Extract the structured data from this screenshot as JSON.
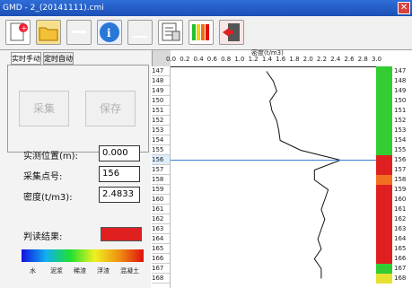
{
  "window": {
    "title": "GMD - 2_(20141111).cmi"
  },
  "toolbar": {
    "icons": [
      "new-file-icon",
      "open-folder-icon",
      "disabled-icon",
      "info-icon",
      "disabled-icon",
      "report-icon",
      "color-bars-icon",
      "exit-icon"
    ]
  },
  "tabs": [
    "实时手动",
    "定时自动"
  ],
  "buttons": {
    "collect": "采集",
    "save": "保存"
  },
  "fields": {
    "position_label": "实测位置(m):",
    "position_value": "0.000",
    "point_label": "采集点号:",
    "point_value": "156",
    "density_label": "密度(t/m3):",
    "density_value": "2.4833"
  },
  "result": {
    "label": "判读结果:",
    "color": "#e02020"
  },
  "colorbar": {
    "labels": [
      "水",
      "泥浆",
      "稀渣",
      "浮渣",
      "混凝土"
    ]
  },
  "chart": {
    "axis_label": "密度(t/m3)",
    "ticks": [
      "0.0",
      "0.2",
      "0.4",
      "0.6",
      "0.8",
      "1.0",
      "1.2",
      "1.4",
      "1.6",
      "1.8",
      "2.0",
      "2.2",
      "2.4",
      "2.6",
      "2.8",
      "3.0"
    ]
  },
  "depth_labels": [
    "147",
    "148",
    "149",
    "150",
    "151",
    "152",
    "153",
    "154",
    "155",
    "156",
    "157",
    "158",
    "159",
    "160",
    "161",
    "162",
    "163",
    "164",
    "165",
    "166",
    "167",
    "168"
  ],
  "result_colors": [
    "#33cc33",
    "#33cc33",
    "#33cc33",
    "#33cc33",
    "#33cc33",
    "#33cc33",
    "#33cc33",
    "#33cc33",
    "#33cc33",
    "#e02020",
    "#e02020",
    "#f07020",
    "#e02020",
    "#e02020",
    "#e02020",
    "#e02020",
    "#e02020",
    "#e02020",
    "#e02020",
    "#e02020",
    "#33cc33",
    "#e6e030"
  ],
  "chart_data": {
    "type": "line",
    "xlabel": "密度(t/m3)",
    "xlim": [
      0.0,
      3.0
    ],
    "ylim": [
      147,
      168
    ],
    "y": [
      147,
      148,
      149,
      150,
      151,
      152,
      153,
      154,
      155,
      156,
      157,
      158,
      159,
      160,
      161,
      162,
      163,
      164,
      165,
      166,
      167,
      168
    ],
    "x": [
      1.4,
      1.5,
      1.55,
      1.45,
      1.48,
      1.55,
      1.58,
      1.6,
      1.9,
      2.48,
      2.1,
      2.1,
      2.3,
      2.25,
      2.2,
      2.25,
      2.2,
      2.15,
      2.2,
      2.1,
      2.2,
      2.2
    ],
    "marker_y": 156
  }
}
